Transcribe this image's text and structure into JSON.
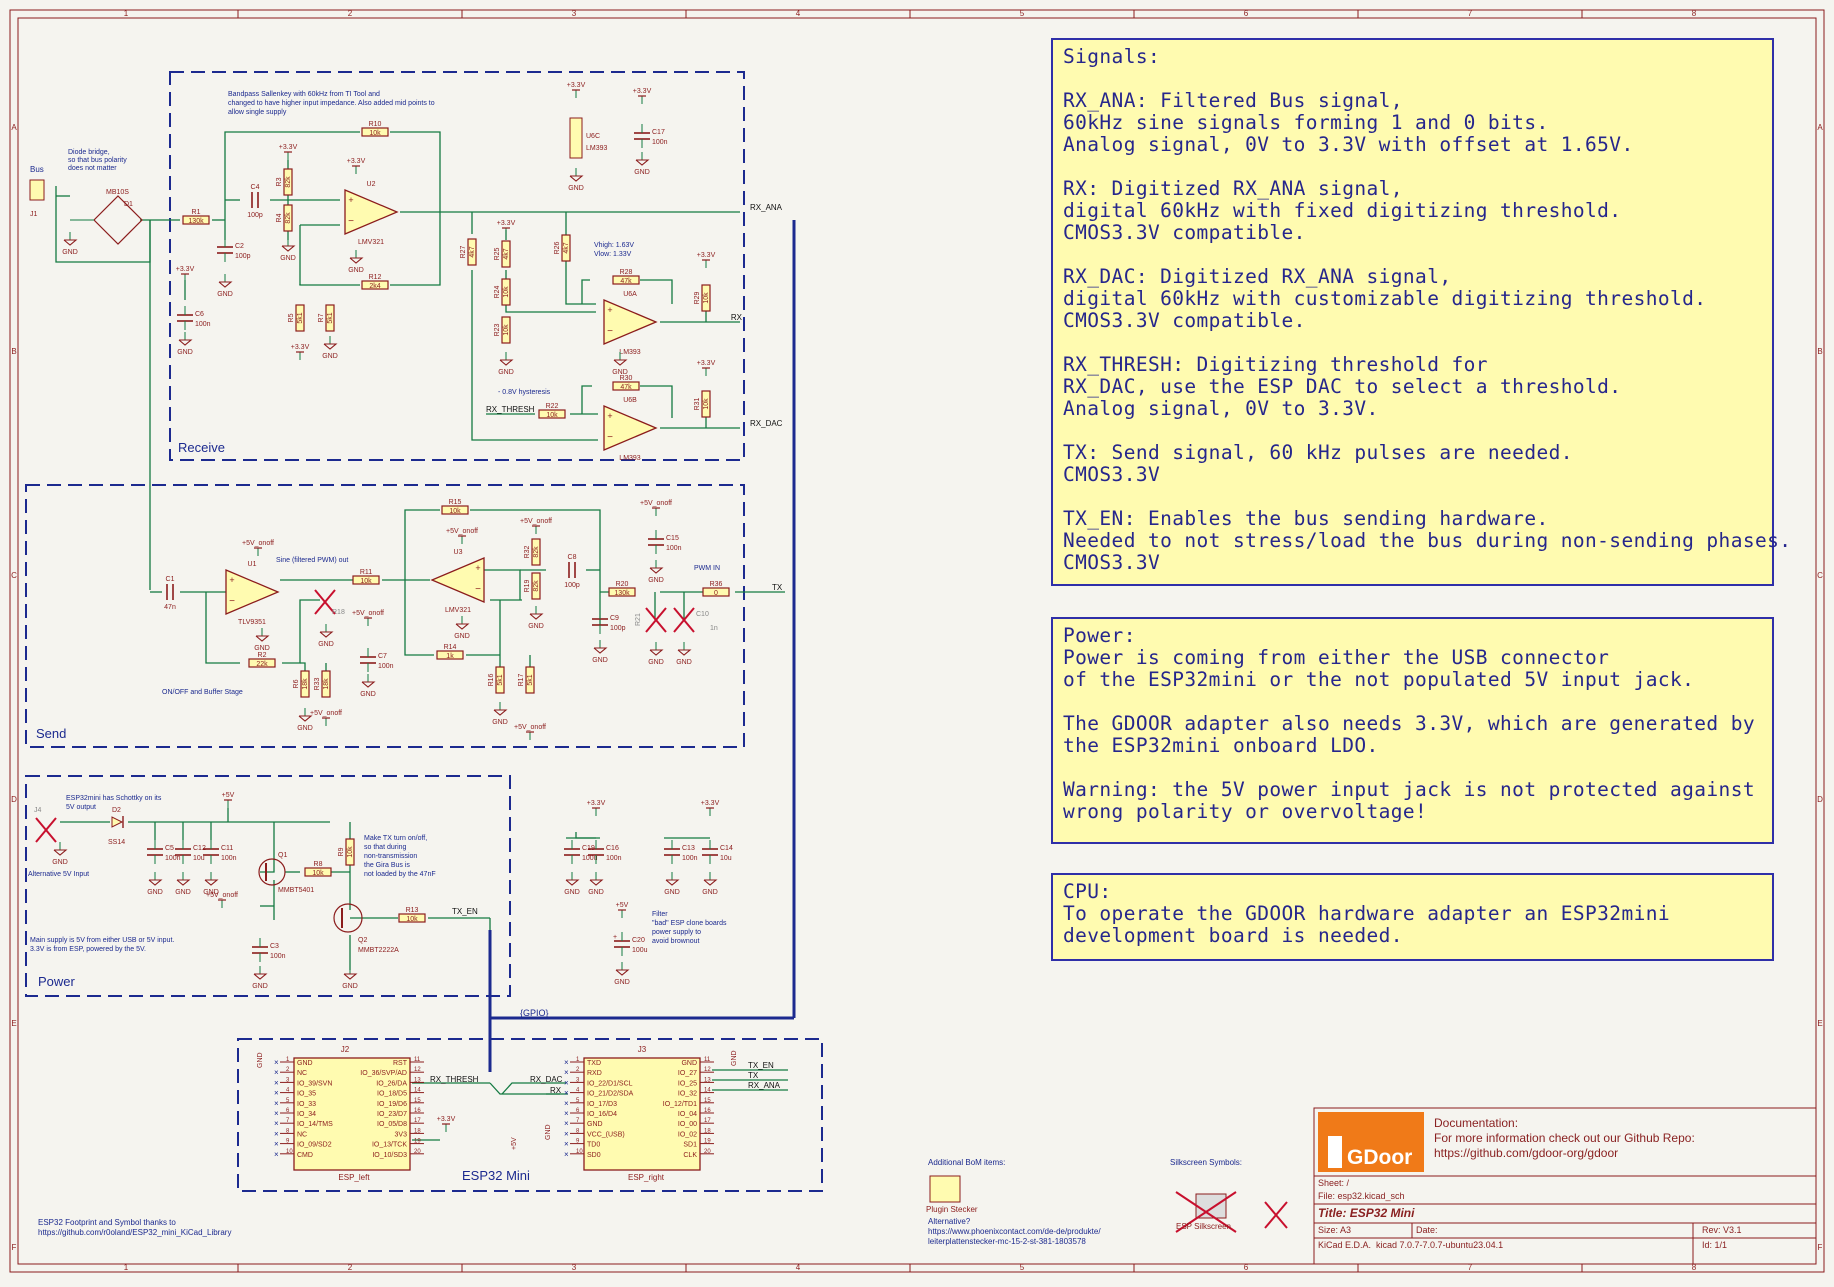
{
  "frame": {
    "col_numbers": [
      "1",
      "2",
      "3",
      "4",
      "5",
      "6",
      "7",
      "8"
    ],
    "row_letters": [
      "A",
      "B",
      "C",
      "D",
      "E",
      "F"
    ]
  },
  "colors": {
    "wire": "#147a42",
    "border": "#1c2a8f",
    "symbol": "#8b1c1c",
    "text": "#1c2a8f",
    "note_bg": "#fffbb0"
  },
  "notes": {
    "signals": [
      "Signals:",
      "",
      "RX_ANA: Filtered Bus signal,",
      "60kHz sine signals forming 1 and 0 bits.",
      "Analog signal, 0V to 3.3V with offset at 1.65V.",
      "",
      "RX: Digitized RX_ANA signal,",
      "digital 60kHz with fixed digitizing threshold.",
      "CMOS3.3V compatible.",
      "",
      "RX_DAC: Digitized RX_ANA signal,",
      "digital 60kHz with customizable digitizing threshold.",
      "CMOS3.3V compatible.",
      "",
      "RX_THRESH: Digitizing threshold for",
      "RX_DAC, use the ESP DAC to select a threshold.",
      "Analog signal, 0V to 3.3V.",
      "",
      "TX: Send signal, 60 kHz pulses are needed.",
      "CMOS3.3V",
      "",
      "TX_EN: Enables the bus sending hardware.",
      "Needed to not stress/load the bus during non-sending phases.",
      "CMOS3.3V"
    ],
    "power": [
      "Power:",
      "Power is coming from either the USB connector",
      "of the ESP32mini or the not populated 5V input jack.",
      "",
      "The GDOOR adapter also needs 3.3V, which are generated by",
      "the ESP32mini onboard LDO.",
      "",
      "Warning: the 5V power input jack is not protected against",
      "wrong polarity or overvoltage!"
    ],
    "cpu": [
      "CPU:",
      "To operate the GDOOR hardware adapter an ESP32mini",
      "development board is needed."
    ]
  },
  "sections": {
    "receive": "Receive",
    "send": "Send",
    "power": "Power",
    "esp32": "ESP32 Mini"
  },
  "receive": {
    "comment_bandpass": [
      "Bandpass Sallenkey with 60kHz from TI Tool and",
      "changed to have higher input impedance. Also added mid points to",
      "allow single supply"
    ],
    "comment_diode": [
      "Diode bridge,",
      "so that bus polarity",
      "does not matter"
    ],
    "bus_label": "Bus",
    "j1": "J1",
    "bridge": [
      "MB10S",
      "D1"
    ],
    "vhigh": "Vhigh: 1.63V",
    "vlow": "Vlow: 1.33V",
    "hyst": "- 0.8V hysteresis",
    "parts": {
      "R1": [
        "R1",
        "130k"
      ],
      "C4": [
        "C4",
        "100p"
      ],
      "C2": [
        "C2",
        "100p"
      ],
      "R10": [
        "R10",
        "10k"
      ],
      "R3": [
        "R3",
        "82k"
      ],
      "R4": [
        "R4",
        "82k"
      ],
      "R12": [
        "R12",
        "2k4"
      ],
      "R5": [
        "R5",
        "5k1"
      ],
      "R7": [
        "R7",
        "5k1"
      ],
      "C6": [
        "C6",
        "100n"
      ],
      "U2": [
        "U2",
        "LMV321"
      ],
      "U6C": [
        "U6C",
        "LM393"
      ],
      "C17": [
        "C17",
        "100n"
      ],
      "R27": [
        "R27",
        "4k7"
      ],
      "R25": [
        "R25",
        "4k7"
      ],
      "R24": [
        "R24",
        "10k"
      ],
      "R23": [
        "R23",
        "10k"
      ],
      "R26": [
        "R26",
        "4k7"
      ],
      "R28": [
        "R28",
        "47k"
      ],
      "R29": [
        "R29",
        "10k"
      ],
      "U6A": [
        "U6A",
        "LM393"
      ],
      "R30": [
        "R30",
        "47k"
      ],
      "R22": [
        "R22",
        "10k"
      ],
      "R31": [
        "R31",
        "10k"
      ],
      "U6B": [
        "U6B",
        "LM393"
      ]
    }
  },
  "send": {
    "sine_label": "Sine (filtered PWM) out",
    "buffer_label": "ON/OFF and Buffer Stage",
    "pwm_in": "PWM IN",
    "parts": {
      "C1": [
        "C1",
        "47n"
      ],
      "U1": [
        "U1",
        "TLV9351"
      ],
      "R2": [
        "R2",
        "22k"
      ],
      "R6": [
        "R6",
        "18k"
      ],
      "R33": [
        "R33",
        "18k"
      ],
      "R18": [
        "R18",
        "100p"
      ],
      "R11": [
        "R11",
        "10k"
      ],
      "R15": [
        "R15",
        "10k"
      ],
      "U3": [
        "U3",
        "LMV321"
      ],
      "R14": [
        "R14",
        "1k"
      ],
      "C7": [
        "C7",
        "100n"
      ],
      "R16": [
        "R16",
        "5k1"
      ],
      "R17": [
        "R17",
        "5k1"
      ],
      "R32": [
        "R32",
        "82k"
      ],
      "R19": [
        "R19",
        "82k"
      ],
      "C8": [
        "C8",
        "100p"
      ],
      "C9": [
        "C9",
        "100p"
      ],
      "R20": [
        "R20",
        "130k"
      ],
      "C15": [
        "C15",
        "100n"
      ],
      "R21": [
        "R21",
        "NP"
      ],
      "C10": [
        "C10",
        "1n"
      ],
      "R36": [
        "R36",
        "0"
      ]
    }
  },
  "power": {
    "comment_schottky": [
      "ESP32mini has Schottky on its",
      "5V output"
    ],
    "alt_input": "Alternative 5V Input",
    "comment_tx": [
      "Make TX turn on/off,",
      "so that during",
      "non-transmission",
      "the Gira Bus is",
      "not loaded by the 47nF"
    ],
    "comment_supply": [
      "Main supply is 5V from either USB or 5V input.",
      "3.3V is from ESP, powered by the 5V."
    ],
    "comment_filter": [
      "Filter",
      "\"bad\" ESP clone boards",
      "power supply to",
      "avoid brownout"
    ],
    "parts": {
      "J4": [
        "J4"
      ],
      "D2": [
        "D2",
        "SS14"
      ],
      "C5": [
        "C5",
        "100n"
      ],
      "C12": [
        "C12",
        "10u"
      ],
      "C11": [
        "C11",
        "100n"
      ],
      "Q1": [
        "Q1",
        "MMBT5401"
      ],
      "R8": [
        "R8",
        "10k"
      ],
      "R9": [
        "R9",
        "10k"
      ],
      "Q2": [
        "Q2",
        "MMBT2222A"
      ],
      "R13": [
        "R13",
        "10k"
      ],
      "C3": [
        "C3",
        "100n"
      ],
      "C19": [
        "C19",
        "100u"
      ],
      "C16": [
        "C16",
        "100n"
      ],
      "C13": [
        "C13",
        "100n"
      ],
      "C14": [
        "C14",
        "10u"
      ],
      "C20": [
        "C20",
        "100u"
      ]
    }
  },
  "power_labels": {
    "v33": "+3.3V",
    "v5": "+5V",
    "v5off": "+5V_onoff",
    "gnd": "GND"
  },
  "nets": {
    "rx_ana": "RX_ANA",
    "rx": "RX",
    "rx_dac": "RX_DAC",
    "rx_thresh": "RX_THRESH",
    "tx": "TX",
    "tx_en": "TX_EN",
    "gpio": "{GPIO}"
  },
  "esp": {
    "j2": "J2",
    "j2_name": "ESP_left",
    "j3": "J3",
    "j3_name": "ESP_right",
    "left_left": [
      "GND",
      "NC",
      "IO_39/SVN",
      "IO_35",
      "IO_33",
      "IO_34",
      "IO_14/TMS",
      "NC",
      "IO_09/SD2",
      "CMD"
    ],
    "left_right": [
      "RST",
      "IO_36/SVP/AD",
      "IO_26/DA",
      "IO_18/D5",
      "IO_19/D6",
      "IO_23/D7",
      "IO_05/D8",
      "3V3",
      "IO_13/TCK",
      "IO_10/SD3"
    ],
    "right_left": [
      "TXD",
      "RXD",
      "IO_22/D1/SCL",
      "IO_21/D2/SDA",
      "IO_17/D3",
      "IO_16/D4",
      "GND",
      "VCC_(USB)",
      "TD0",
      "SD0"
    ],
    "right_right": [
      "GND",
      "IO_27",
      "IO_25",
      "IO_32",
      "IO_12/TD1",
      "IO_04",
      "IO_00",
      "IO_02",
      "SD1",
      "CLK"
    ]
  },
  "footer": {
    "esp_credit": [
      "ESP32 Footprint and Symbol thanks to",
      "https://github.com/r0oland/ESP32_mini_KiCad_Library"
    ],
    "bom_title": "Additional BoM items:",
    "plugin": "Plugin Stecker",
    "alternative": [
      "Alternative?",
      "https://www.phoenixcontact.com/de-de/produkte/",
      "leiterplattenstecker-mc-15-2-st-381-1803578"
    ],
    "silk_title": "Silkscreen Symbols:",
    "silk_label": "ESP Silkscreen"
  },
  "title_block": {
    "logo": "GDoor",
    "doc_heading": "Documentation:",
    "doc_lines": [
      "For more information check out our Github Repo:",
      "https://github.com/gdoor-org/gdoor"
    ],
    "sheet": "Sheet: /",
    "file": "File: esp32.kicad_sch",
    "title": "Title: ESP32 Mini",
    "size": "Size: A3",
    "date": "Date:",
    "rev": "Rev: V3.1",
    "tool": "KiCad E.D.A.  kicad 7.0.7-7.0.7-ubuntu23.04.1",
    "id": "Id: 1/1"
  }
}
